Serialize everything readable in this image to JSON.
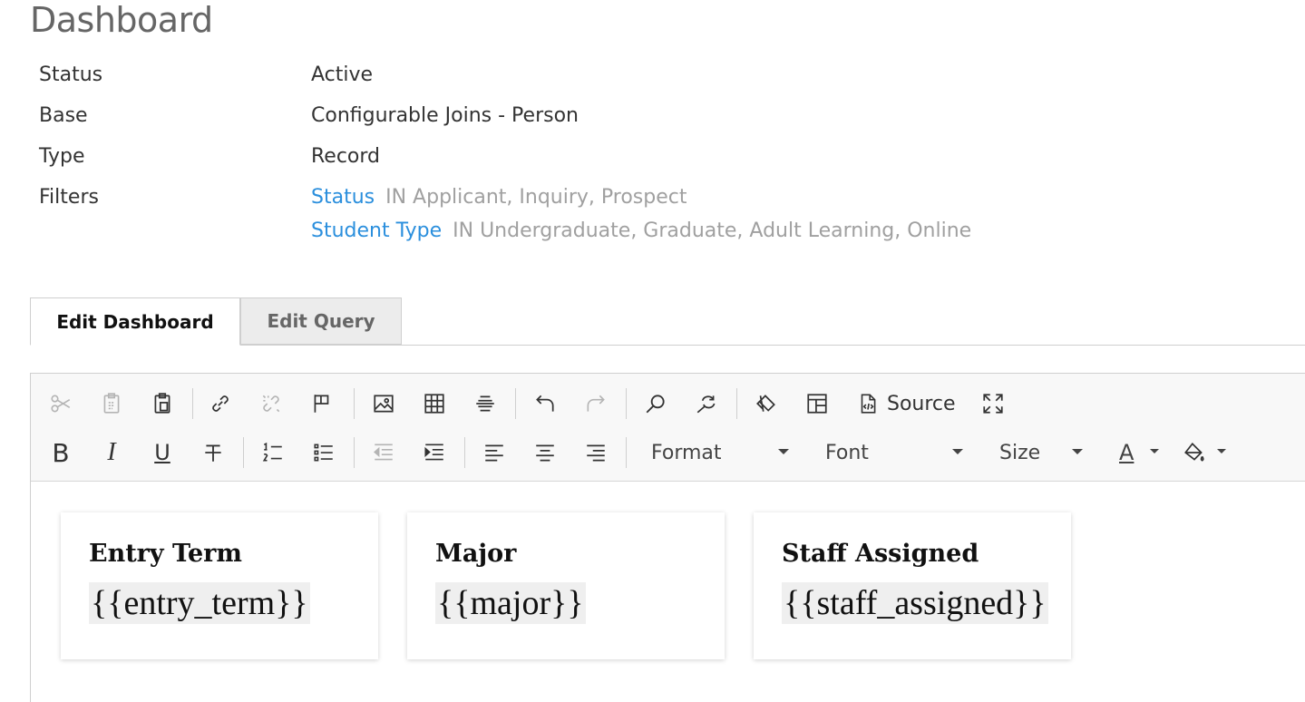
{
  "page": {
    "title": "Dashboard"
  },
  "properties": [
    {
      "key": "Status",
      "value": "Active"
    },
    {
      "key": "Base",
      "value": "Configurable Joins - Person"
    },
    {
      "key": "Type",
      "value": "Record"
    }
  ],
  "filters": {
    "label": "Filters",
    "items": [
      {
        "field": "Status",
        "condition": "IN Applicant, Inquiry, Prospect"
      },
      {
        "field": "Student Type",
        "condition": "IN Undergraduate, Graduate, Adult Learning, Online"
      }
    ]
  },
  "tabs": [
    {
      "label": "Edit Dashboard",
      "active": true
    },
    {
      "label": "Edit Query",
      "active": false
    }
  ],
  "toolbar": {
    "source_label": "Source",
    "format_label": "Format",
    "font_label": "Font",
    "size_label": "Size",
    "bold_glyph": "B",
    "italic_glyph": "I",
    "underline_glyph": "U",
    "text_color_glyph": "A",
    "icons": {
      "row1": [
        "cut-icon",
        "copy-icon",
        "paste-icon",
        "link-icon",
        "unlink-icon",
        "anchor-icon",
        "image-icon",
        "table-icon",
        "horizontal-line-icon",
        "undo-icon",
        "redo-icon",
        "find-icon",
        "replace-icon",
        "remove-format-icon",
        "templates-icon",
        "source-icon",
        "maximize-icon"
      ],
      "row2": [
        "bold-icon",
        "italic-icon",
        "underline-icon",
        "strikethrough-icon",
        "numbered-list-icon",
        "bulleted-list-icon",
        "outdent-icon",
        "indent-icon",
        "align-left-icon",
        "align-center-icon",
        "align-right-icon",
        "text-color-icon",
        "background-color-icon"
      ]
    }
  },
  "cards": [
    {
      "title": "Entry Term",
      "token": "{{entry_term}}"
    },
    {
      "title": "Major",
      "token": "{{major}}"
    },
    {
      "title": "Staff Assigned",
      "token": "{{staff_assigned}}"
    }
  ]
}
